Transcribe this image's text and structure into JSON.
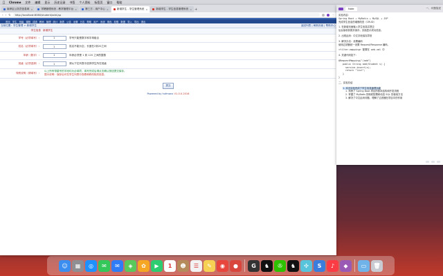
{
  "menubar": {
    "apple": "",
    "items": [
      "Chrome",
      "文件",
      "编辑",
      "显示",
      "历史记录",
      "书签",
      "个人资料",
      "标签页",
      "窗口",
      "帮助"
    ]
  },
  "browser": {
    "tabs": [
      {
        "label": "南岸区公务员信息网",
        "active": false,
        "favColor": "blue"
      },
      {
        "label": "学籍管理系统 - 教学管理平台",
        "active": false,
        "favColor": "blue"
      },
      {
        "label": "第三方 - 用户中心",
        "active": false,
        "favColor": "blue"
      },
      {
        "label": "新增学生 - 学生管理系统",
        "active": true,
        "favColor": "red"
      },
      {
        "label": "新增学生 - 学生信息管理系统",
        "active": false,
        "favColor": "red"
      }
    ],
    "url": "http://localhost:8080/student/add.jsp"
  },
  "page": {
    "nav_items": [
      "首页",
      "学生",
      "班级",
      "课程",
      "成绩",
      "教师",
      "管理",
      "统计",
      "报表",
      "公告",
      "设置",
      "日志",
      "帮助",
      "用户",
      "系统",
      "角色",
      "权限",
      "数据",
      "导入",
      "导出",
      "退出"
    ],
    "crumb": "当前位置：学生管理 > 新增学生",
    "crumb_links": "返回列表 | 刷新页面 | 帮助中心",
    "table_head": {
      "label": "学生信息",
      "value": "新增学生"
    },
    "rows": [
      {
        "label": "学号（必须填写）：",
        "value": "1",
        "hint": "学号只能是数字和字母组合",
        "hint_style": "normal"
      },
      {
        "label": "姓名（必须填写）：",
        "value": "1",
        "hint": "姓名不能为空，长度在2到20之间",
        "hint_style": "normal"
      },
      {
        "label": "年龄（数字）：",
        "value": "1",
        "hint": "年龄必须是 1 到 120 之间的整数",
        "hint_style": "normal"
      },
      {
        "label": "班级（必须选择）：",
        "value": "1",
        "hint": "请从下拉列表中选择学生所在班级",
        "hint_style": "normal"
      }
    ],
    "remark_label": "特别说明（请填写）：",
    "remark_line1": "以上所有带星号的字段均为必填项，填写完成后请点击确认按钮提交保存。",
    "remark_line2": "提示说明：保存后可在学生列表中查看和修改相关信息。",
    "submit_label": "提交",
    "footer_text": "Powered by hufmanx",
    "footer_version": "V1.0.0.2016"
  },
  "notes": {
    "tab_label": "Note",
    "title": "一、问题描述",
    "lines": [
      {
        "text": "实验内容：",
        "cls": ""
      },
      {
        "text": "Spring Boot + MyBatis + MySQL + JSP",
        "cls": "mono"
      },
      {
        "text": "完成学生信息的增删改查（CRUD）",
        "cls": ""
      },
      {
        "text": "",
        "cls": "gap"
      },
      {
        "text": "1. 在新增页面输入学生信息并提交",
        "cls": ""
      },
      {
        "text": "后台接收参数并保存，页面显示成功信息。",
        "cls": ""
      },
      {
        "text": "",
        "cls": "gap"
      },
      {
        "text": "2. 出现乱码：中文字段保存异常",
        "cls": ""
      },
      {
        "text": "",
        "cls": "gap"
      },
      {
        "text": "3. 解决办法：设置编码",
        "cls": ""
      },
      {
        "text": "使用过滤器统一设置 Request/Response 编码。",
        "cls": ""
      },
      {
        "text": "",
        "cls": "gap"
      },
      {
        "text": "<filter-mapping> 配置在 web.xml 中",
        "cls": "mono"
      },
      {
        "text": "",
        "cls": "gap"
      },
      {
        "text": "4. 关键代码如下：",
        "cls": ""
      },
      {
        "text": "",
        "cls": "gap"
      },
      {
        "text": "@RequestMapping(\"/add\")",
        "cls": "mono"
      },
      {
        "text": "public String add(Student s) {",
        "cls": "mono indent"
      },
      {
        "text": "  service.insert(s);",
        "cls": "mono indent2"
      },
      {
        "text": "  return \"list\";",
        "cls": "mono indent2"
      },
      {
        "text": "}",
        "cls": "mono indent"
      },
      {
        "text": "}",
        "cls": "mono"
      },
      {
        "text": "",
        "cls": "gap"
      },
      {
        "text": "二、实验总结",
        "cls": ""
      },
      {
        "text": "",
        "cls": "gap"
      },
      {
        "text": "1. 本次实验完成了学生信息管理功能",
        "cls": "indent hl-line"
      },
      {
        "text": "1. 熟悉了 Spring Boot 项目的基本结构和开发流程",
        "cls": "indent2"
      },
      {
        "text": "2. 掌握了 MyBatis 的映射配置和动态 SQL 的使用方法",
        "cls": "indent2"
      },
      {
        "text": "3. 解决了中文乱码问题，理解了过滤器在项目中的作用",
        "cls": "indent2"
      }
    ]
  },
  "dock": {
    "icons": [
      {
        "name": "finder",
        "color": "#3b8ef0",
        "glyph": "☺"
      },
      {
        "name": "launchpad",
        "color": "#8e8e93",
        "glyph": "▦"
      },
      {
        "name": "safari",
        "color": "#1e90ff",
        "glyph": "◎"
      },
      {
        "name": "messages",
        "color": "#34c759",
        "glyph": "✉"
      },
      {
        "name": "mail",
        "color": "#2f7cf6",
        "glyph": "✉"
      },
      {
        "name": "maps",
        "color": "#5ac85a",
        "glyph": "◈"
      },
      {
        "name": "photos",
        "color": "#f5a623",
        "glyph": "✿"
      },
      {
        "name": "facetime",
        "color": "#2ecc71",
        "glyph": "▶"
      },
      {
        "name": "calendar",
        "color": "#ffffff",
        "glyph": "1"
      },
      {
        "name": "contacts",
        "color": "#b58b5b",
        "glyph": "☻"
      },
      {
        "name": "reminders",
        "color": "#f2f2f2",
        "glyph": "☰"
      },
      {
        "name": "notes",
        "color": "#f7d154",
        "glyph": "✎"
      },
      {
        "name": "chrome",
        "color": "#e8453c",
        "glyph": "◉"
      },
      {
        "name": "app-red",
        "color": "#d9463e",
        "glyph": "●"
      },
      {
        "name": "sep",
        "color": "",
        "glyph": ""
      },
      {
        "name": "app-g",
        "color": "#333333",
        "glyph": "G"
      },
      {
        "name": "qq",
        "color": "#111111",
        "glyph": "♞"
      },
      {
        "name": "wechat",
        "color": "#2dc100",
        "glyph": "✇"
      },
      {
        "name": "app-qq2",
        "color": "#111111",
        "glyph": "♞"
      },
      {
        "name": "app-grid",
        "color": "#58c4dc",
        "glyph": "✣"
      },
      {
        "name": "app-blue",
        "color": "#3b7ddd",
        "glyph": "S"
      },
      {
        "name": "music",
        "color": "#fc3c44",
        "glyph": "♪"
      },
      {
        "name": "app-purple",
        "color": "#9b59b6",
        "glyph": "◆"
      },
      {
        "name": "sep2",
        "color": "",
        "glyph": ""
      },
      {
        "name": "folder",
        "color": "#6fb3e8",
        "glyph": "▭"
      },
      {
        "name": "trash",
        "color": "#c8ccd2",
        "glyph": "🗑"
      }
    ]
  }
}
